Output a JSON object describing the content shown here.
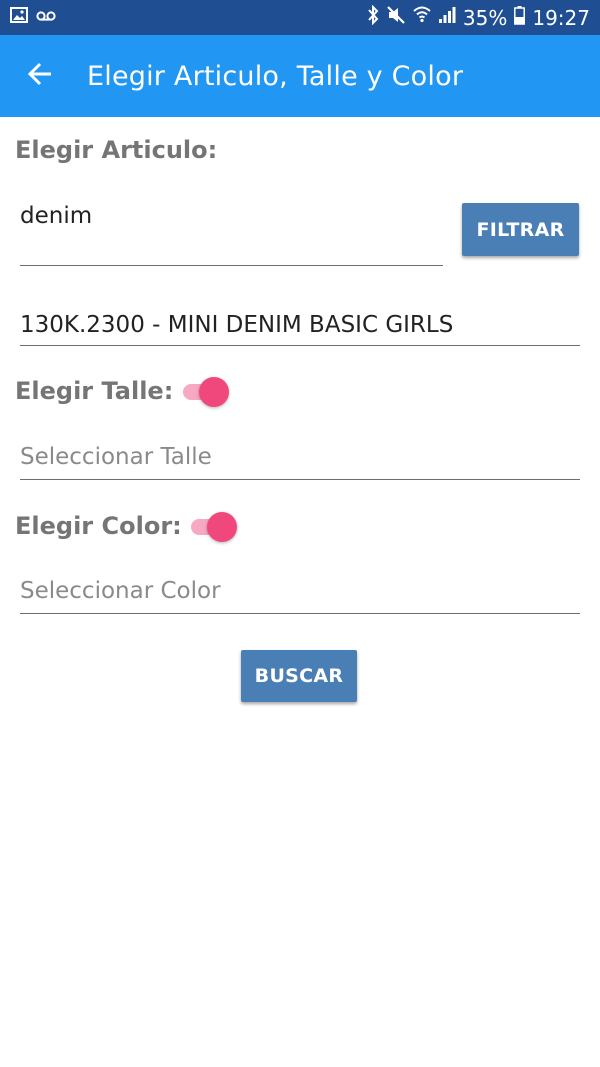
{
  "status_bar": {
    "icons_left": [
      "image-icon",
      "voicemail-icon"
    ],
    "icons_right": [
      "bluetooth-icon",
      "mute-icon",
      "wifi-icon",
      "signal-icon",
      "battery-icon"
    ],
    "battery_text": "35%",
    "time": "19:27"
  },
  "app_bar": {
    "title": "Elegir Articulo, Talle y Color",
    "color": "#2196f3"
  },
  "form": {
    "articulo_label": "Elegir Articulo:",
    "search_value": "denim",
    "filter_button": "FILTRAR",
    "selected_article": "130K.2300 - MINI DENIM BASIC GIRLS",
    "talle_label": "Elegir Talle:",
    "talle_toggle_on": true,
    "talle_placeholder": "Seleccionar Talle",
    "color_label": "Elegir Color:",
    "color_toggle_on": true,
    "color_placeholder": "Seleccionar Color",
    "search_button": "BUSCAR",
    "accent_color": "#f0487c",
    "button_color": "#4a7fb5"
  }
}
